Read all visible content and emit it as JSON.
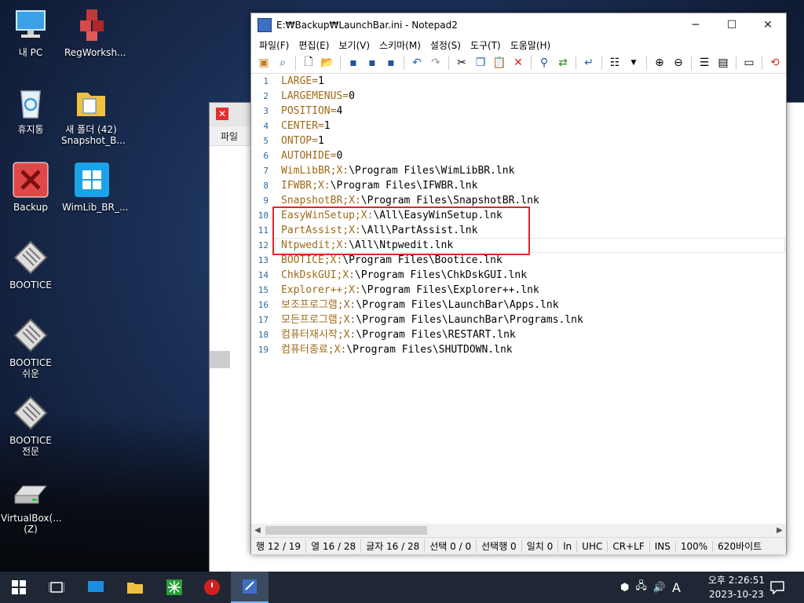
{
  "desktop": {
    "icons": [
      {
        "label": "내 PC"
      },
      {
        "label": "RegWorksh..."
      },
      {
        "label": "휴지통"
      },
      {
        "label": "새 폴더 (42)"
      },
      {
        "label": "Snapshot_B..."
      },
      {
        "label": "Backup"
      },
      {
        "label": "WimLib_BR_..."
      },
      {
        "label": "BOOTICE"
      },
      {
        "label": "BOOTICE"
      },
      {
        "label": "쉬운"
      },
      {
        "label": "BOOTICE"
      },
      {
        "label": "전문"
      },
      {
        "label": "VirtualBox(..."
      },
      {
        "label": "(Z)"
      }
    ]
  },
  "explorer": {
    "file_tab": "파일"
  },
  "notepad": {
    "title": "E:₩Backup₩LaunchBar.ini - Notepad2",
    "menu": [
      "파일(F)",
      "편집(E)",
      "보기(V)",
      "스키마(M)",
      "설정(S)",
      "도구(T)",
      "도움말(H)"
    ],
    "line_numbers": [
      "1",
      "2",
      "3",
      "4",
      "5",
      "6",
      "7",
      "8",
      "9",
      "10",
      "11",
      "12",
      "13",
      "14",
      "15",
      "16",
      "17",
      "18",
      "19"
    ],
    "lines": [
      {
        "key": "LARGE",
        "sep": "=",
        "val": "1"
      },
      {
        "key": "LARGEMENUS",
        "sep": "=",
        "val": "0"
      },
      {
        "key": "POSITION",
        "sep": "=",
        "val": "4"
      },
      {
        "key": "CENTER",
        "sep": "=",
        "val": "1"
      },
      {
        "key": "ONTOP",
        "sep": "=",
        "val": "1"
      },
      {
        "key": "AUTOHIDE",
        "sep": "=",
        "val": "0"
      },
      {
        "key": "WimLibBR;X:",
        "sep": "",
        "val": "\\Program Files\\WimLibBR.lnk"
      },
      {
        "key": "IFWBR;X:",
        "sep": "",
        "val": "\\Program Files\\IFWBR.lnk"
      },
      {
        "key": "SnapshotBR;X:",
        "sep": "",
        "val": "\\Program Files\\SnapshotBR.lnk"
      },
      {
        "key": "EasyWinSetup;X:",
        "sep": "",
        "val": "\\All\\EasyWinSetup.lnk"
      },
      {
        "key": "PartAssist;X:",
        "sep": "",
        "val": "\\All\\PartAssist.lnk"
      },
      {
        "key": "Ntpwedit;X:",
        "sep": "",
        "val": "\\All\\Ntpwedit.lnk"
      },
      {
        "key": "BOOTICE;X:",
        "sep": "",
        "val": "\\Program Files\\Bootice.lnk"
      },
      {
        "key": "ChkDskGUI;X:",
        "sep": "",
        "val": "\\Program Files\\ChkDskGUI.lnk"
      },
      {
        "key": "Explorer++;X:",
        "sep": "",
        "val": "\\Program Files\\Explorer++.lnk"
      },
      {
        "key": "보조프로그램;X:",
        "sep": "",
        "val": "\\Program Files\\LaunchBar\\Apps.lnk"
      },
      {
        "key": "모든프로그램;X:",
        "sep": "",
        "val": "\\Program Files\\LaunchBar\\Programs.lnk"
      },
      {
        "key": "컴퓨터재시작;X:",
        "sep": "",
        "val": "\\Program Files\\RESTART.lnk"
      },
      {
        "key": "컴퓨터종료;X:",
        "sep": "",
        "val": "\\Program Files\\SHUTDOWN.lnk"
      }
    ],
    "status": {
      "row": "행 12 / 19",
      "col": "열 16 / 28",
      "chars": "글자 16 / 28",
      "sel": "선택 0 / 0",
      "selrows": "선택행 0",
      "match": "일치 0",
      "ln": "ln",
      "enc": "UHC",
      "eol": "CR+LF",
      "ins": "INS",
      "zoom": "100%",
      "size": "620바이트"
    }
  },
  "taskbar": {
    "time": "오후 2:26:51",
    "date": "2023-10-23",
    "ime": "A"
  },
  "colors": {
    "key": "#a06a1a",
    "linenum": "#2b6ba3",
    "highlight_box": "#e0252a",
    "taskbar": "#1e2733"
  }
}
